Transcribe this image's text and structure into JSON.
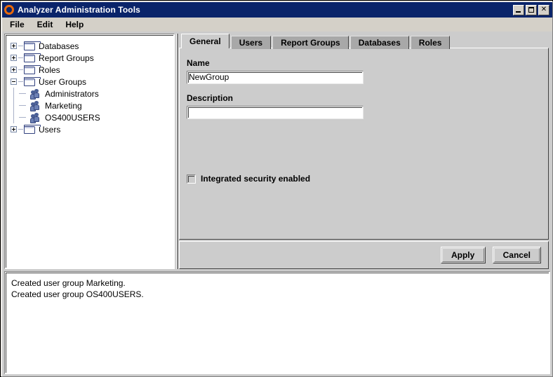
{
  "window": {
    "title": "Analyzer Administration Tools",
    "app_icon": "orange-ring-icon",
    "controls": {
      "minimize": "minimize-button",
      "maximize": "maximize-button",
      "close_label": "✕"
    }
  },
  "menubar": {
    "items": [
      {
        "label": "File"
      },
      {
        "label": "Edit"
      },
      {
        "label": "Help"
      }
    ]
  },
  "tree": {
    "nodes": [
      {
        "label": "Databases",
        "icon": "folder-icon",
        "expanded": false,
        "level": 0
      },
      {
        "label": "Report Groups",
        "icon": "folder-icon",
        "expanded": false,
        "level": 0
      },
      {
        "label": "Roles",
        "icon": "folder-icon",
        "expanded": false,
        "level": 0
      },
      {
        "label": "User Groups",
        "icon": "folder-icon",
        "expanded": true,
        "level": 0
      },
      {
        "label": "Administrators",
        "icon": "user-group-icon",
        "level": 1
      },
      {
        "label": "Marketing",
        "icon": "user-group-icon",
        "level": 1
      },
      {
        "label": "OS400USERS",
        "icon": "user-group-icon",
        "level": 1
      },
      {
        "label": "Users",
        "icon": "folder-icon",
        "expanded": false,
        "level": 0
      }
    ]
  },
  "tabs": {
    "selected": "General",
    "items": [
      {
        "label": "General"
      },
      {
        "label": "Users"
      },
      {
        "label": "Report Groups"
      },
      {
        "label": "Databases"
      },
      {
        "label": "Roles"
      }
    ]
  },
  "form": {
    "name_label": "Name",
    "name_value": "NewGroup",
    "name_placeholder": "",
    "description_label": "Description",
    "description_value": "",
    "description_placeholder": "",
    "integrated_security_label": "Integrated security enabled",
    "integrated_security_checked": false
  },
  "buttons": {
    "apply_label": "Apply",
    "cancel_label": "Cancel"
  },
  "log": {
    "lines": [
      "Created user group Marketing.",
      "Created user group OS400USERS."
    ]
  },
  "colors": {
    "titlebar": "#0a246a",
    "accent": "#e8690b",
    "panel": "#cccccc",
    "frame": "#d4d0c8",
    "tab_unselected": "#a8a8a8",
    "tree_lines": "#a8b0c8",
    "folder_outline": "#33427f"
  }
}
